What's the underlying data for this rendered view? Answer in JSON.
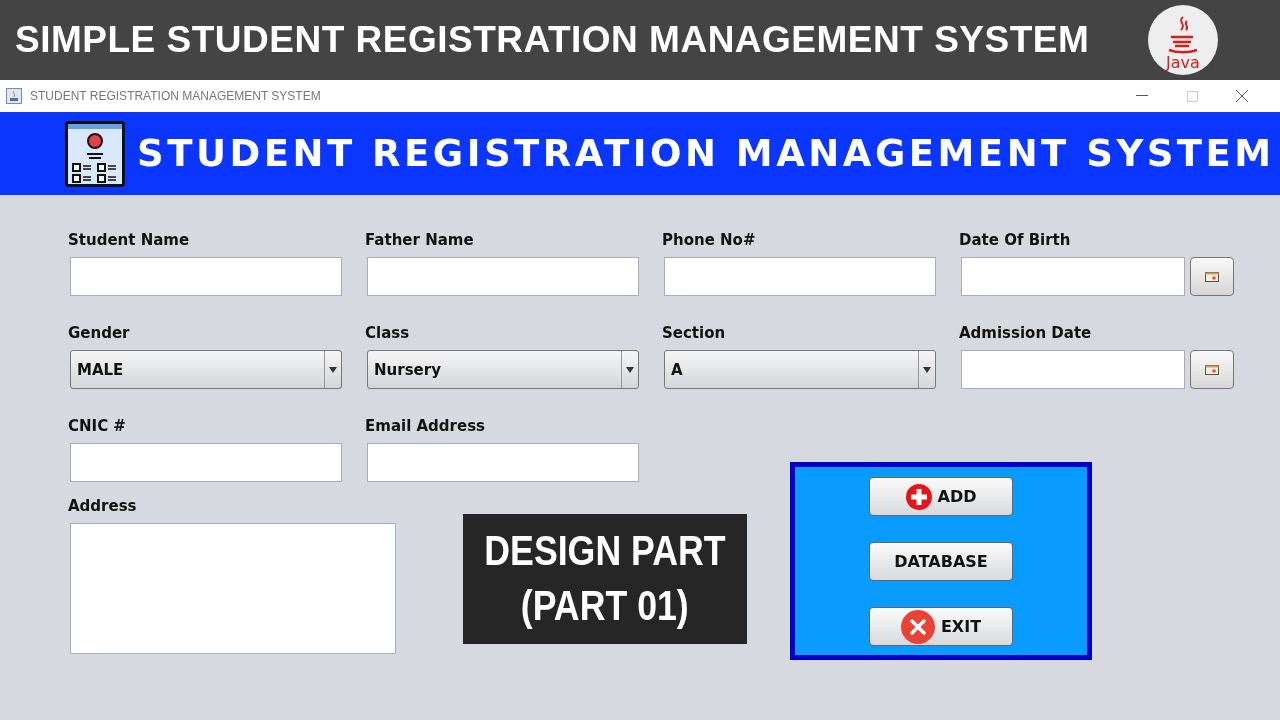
{
  "banner": {
    "title": "SIMPLE STUDENT REGISTRATION MANAGEMENT SYSTEM",
    "logo_text": "Java"
  },
  "window": {
    "title": "STUDENT REGISTRATION MANAGEMENT SYSTEM"
  },
  "header": {
    "title": "STUDENT REGISTRATION MANAGEMENT SYSTEM"
  },
  "fields": [
    {
      "label": "Student Name",
      "kind": "text"
    },
    {
      "label": "Father Name",
      "kind": "text"
    },
    {
      "label": "Phone No#",
      "kind": "text"
    },
    {
      "label": "Date Of Birth",
      "kind": "date"
    },
    {
      "label": "Gender",
      "kind": "combo",
      "value": "MALE"
    },
    {
      "label": "Class",
      "kind": "combo",
      "value": "Nursery"
    },
    {
      "label": "Section",
      "kind": "combo",
      "value": "A"
    },
    {
      "label": "Admission Date",
      "kind": "date"
    },
    {
      "label": "CNIC #",
      "kind": "text"
    },
    {
      "label": "Email Address",
      "kind": "text"
    }
  ],
  "address": {
    "label": "Address"
  },
  "overlay": {
    "lines": [
      "DESIGN PART",
      "(PART 01)"
    ]
  },
  "buttons": [
    {
      "label": "ADD",
      "kind": "add"
    },
    {
      "label": "DATABASE",
      "kind": "plain"
    },
    {
      "label": "EXIT",
      "kind": "exit"
    }
  ]
}
